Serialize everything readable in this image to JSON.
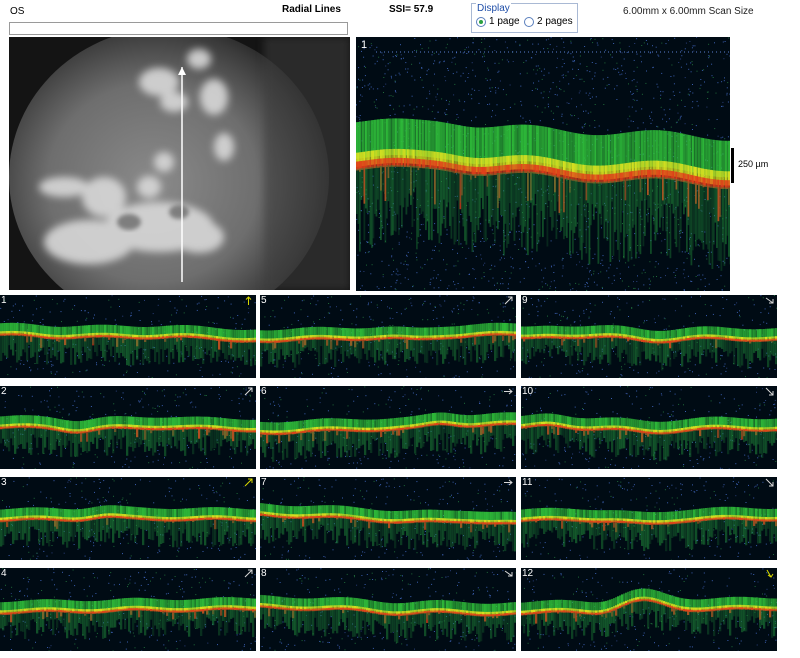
{
  "header": {
    "eye": "OS",
    "scan_pattern": "Radial Lines",
    "ssi": "SSI= 57.9",
    "scan_size": "6.00mm x 6.00mm Scan Size",
    "display": {
      "legend": "Display",
      "options": [
        {
          "label": "1 page",
          "selected": true
        },
        {
          "label": "2 pages",
          "selected": false
        }
      ]
    }
  },
  "main_scan": {
    "number": "1",
    "scale_label": "250 µm"
  },
  "thumbnails": [
    {
      "number": "1"
    },
    {
      "number": "2"
    },
    {
      "number": "3"
    },
    {
      "number": "4"
    },
    {
      "number": "5"
    },
    {
      "number": "6"
    },
    {
      "number": "7"
    },
    {
      "number": "8"
    },
    {
      "number": "9"
    },
    {
      "number": "10"
    },
    {
      "number": "11"
    },
    {
      "number": "12"
    }
  ],
  "colors": {
    "background_scan": "#000b14",
    "layer_green": "#2fbf3a",
    "layer_yellow": "#d8e020",
    "layer_red": "#e0401a",
    "noise_blue": "#3a5fb0",
    "arrow_icon": "#d8d800"
  }
}
